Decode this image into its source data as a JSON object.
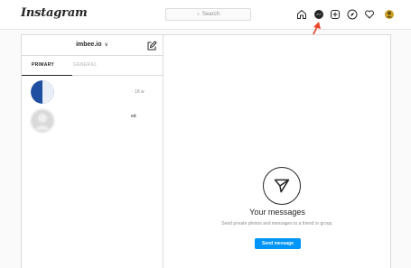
{
  "header": {
    "logo": "Instagram",
    "search": {
      "placeholder": "Search",
      "icon": "search-icon"
    },
    "nav_icons": [
      "home-icon",
      "messenger-icon",
      "new-post-icon",
      "explore-icon",
      "activity-heart-icon",
      "profile-avatar"
    ]
  },
  "sidebar": {
    "account_name": "imbee.io",
    "account_chevron": "∨",
    "compose_icon": "compose-icon",
    "tabs": [
      {
        "label": "PRIMARY",
        "active": true
      },
      {
        "label": "GENERAL",
        "active": false
      }
    ],
    "threads": [
      {
        "meta": "· 18 w",
        "avatar_color": "#1f4fa0"
      },
      {
        "meta": "ed",
        "avatar_color": "#d9d9d9"
      }
    ]
  },
  "main": {
    "icon": "paper-plane-icon",
    "title": "Your messages",
    "subtitle": "Send private photos and messages to a friend or group.",
    "button_label": "Send message"
  },
  "colors": {
    "accent": "#0095f6",
    "annotation_arrow": "#e8472b",
    "border": "#dbdbdb"
  }
}
